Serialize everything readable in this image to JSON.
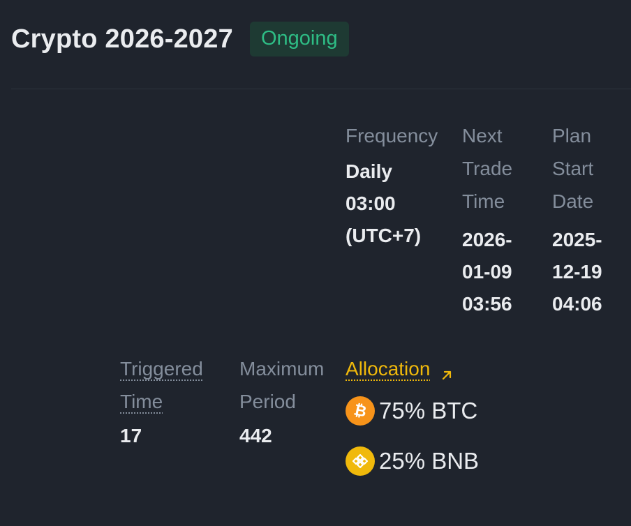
{
  "plan": {
    "title": "Crypto 2026-2027",
    "status": "Ongoing"
  },
  "schedule": {
    "frequency": {
      "label": "Frequency",
      "value_lines": [
        "Daily",
        "03:00",
        "(UTC+7)"
      ]
    },
    "next_trade_time": {
      "label_lines": [
        "Next",
        "Trade",
        "Time"
      ],
      "value_lines": [
        "2026-",
        "01-09",
        "03:56"
      ]
    },
    "plan_start_date": {
      "label_lines": [
        "Plan",
        "Start",
        "Date"
      ],
      "value_lines": [
        "2025-",
        "12-19",
        "04:06"
      ]
    }
  },
  "stats": {
    "triggered_time": {
      "label_lines": [
        "Triggered",
        "Time"
      ],
      "value": "17"
    },
    "maximum_period": {
      "label_lines": [
        "Maximum",
        "Period"
      ],
      "value": "442"
    }
  },
  "allocation": {
    "label": "Allocation",
    "link_icon": "arrow-up-right-icon",
    "assets": [
      {
        "percent_text": "75% BTC",
        "icon": "btc-coin-icon",
        "color": "#f7931a"
      },
      {
        "percent_text": "25% BNB",
        "icon": "bnb-coin-icon",
        "color": "#f0b90b"
      }
    ]
  },
  "colors": {
    "background": "#1f242d",
    "accent": "#f0b90b",
    "status_green": "#2ebd85",
    "muted_text": "#848e9c",
    "primary_text": "#eaecef"
  }
}
